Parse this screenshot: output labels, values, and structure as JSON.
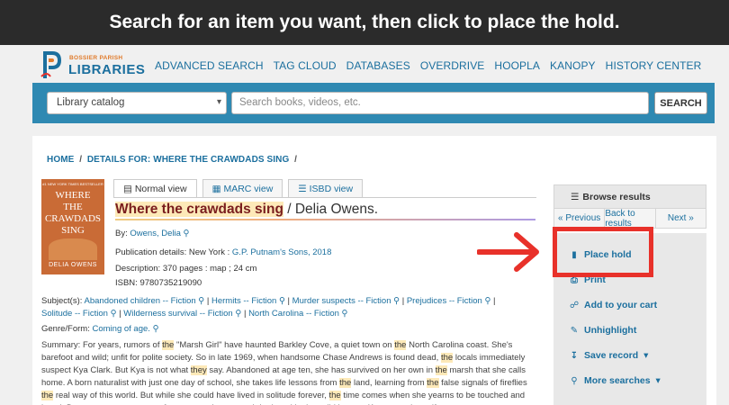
{
  "banner": {
    "text": "Search for an item you want, then click to place the hold."
  },
  "logo": {
    "top_text": "BOSSIER PARISH",
    "bottom_text": "LIBRARIES"
  },
  "topnav": [
    "ADVANCED SEARCH",
    "TAG CLOUD",
    "DATABASES",
    "OVERDRIVE",
    "HOOPLA",
    "KANOPY",
    "HISTORY CENTER"
  ],
  "search": {
    "select_value": "Library catalog",
    "placeholder": "Search books, videos, etc.",
    "button": "SEARCH"
  },
  "breadcrumb": {
    "home": "HOME",
    "sep": "/",
    "details": "DETAILS FOR: WHERE THE CRAWDADS SING",
    "trail": "/"
  },
  "cover": {
    "line1": "WHERE",
    "line2": "THE",
    "line3": "CRAWDADS",
    "line4": "SING",
    "author": "DELIA OWENS",
    "blurb": "#1 NEW YORK TIMES BESTSELLER"
  },
  "tabs": [
    "Normal view",
    "MARC view",
    "ISBD view"
  ],
  "record": {
    "title": "Where the crawdads sing",
    "sep": " / ",
    "author": "Delia Owens.",
    "by_label": "By:",
    "by_value": "Owens, Delia",
    "pub_label": "Publication details:",
    "pub_place": "New York :",
    "pub_value": "G.P. Putnam's Sons, 2018",
    "desc_label": "Description:",
    "desc_value": "370 pages : map ; 24 cm",
    "isbn_label": "ISBN:",
    "isbn_value": "9780735219090",
    "subjects_label": "Subject(s):",
    "subjects": [
      "Abandoned children -- Fiction",
      "Hermits -- Fiction",
      "Murder suspects -- Fiction",
      "Prejudices -- Fiction",
      "Solitude -- Fiction",
      "Wilderness survival -- Fiction",
      "North Carolina -- Fiction"
    ],
    "genre_label": "Genre/Form:",
    "genre_value": "Coming of age.",
    "summary_label": "Summary:",
    "summary": "For years, rumors of the \"Marsh Girl\" have haunted Barkley Cove, a quiet town on the North Carolina coast. She's barefoot and wild; unfit for polite society. So in late 1969, when handsome Chase Andrews is found dead, the locals immediately suspect Kya Clark. But Kya is not what they say. Abandoned at age ten, she has survived on her own in the marsh that she calls home. A born naturalist with just one day of school, she takes life lessons from the land, learning from the false signals of fireflies the real way of this world. But while she could have lived in solitude forever, the time comes when she yearns to be touched and loved. Drawn to two young men from town, who are each intrigued by her wild beauty, Kya opens herself to a"
  },
  "sidebar": {
    "browse": "Browse results",
    "prev": "« Previous",
    "back": "Back to results",
    "next": "Next »",
    "actions": [
      "Place hold",
      "Print",
      "Add to your cart",
      "Unhighlight",
      "Save record",
      "More searches"
    ]
  },
  "colors": {
    "accent": "#1b6f9e",
    "bar": "#2f89b2",
    "highlight": "#e8312a"
  }
}
